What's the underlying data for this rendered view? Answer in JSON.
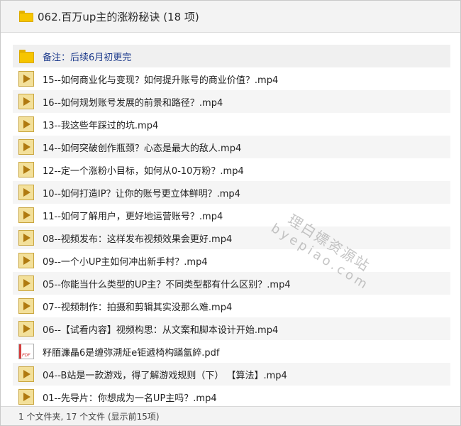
{
  "window": {
    "title": "062.百万up主的涨粉秘诀 (18 项)"
  },
  "items": [
    {
      "type": "folder",
      "name": "备注：后续6月初更完"
    },
    {
      "type": "video",
      "name": "15--如何商业化与变现？如何提升账号的商业价值？.mp4"
    },
    {
      "type": "video",
      "name": "16--如何规划账号发展的前景和路径？.mp4"
    },
    {
      "type": "video",
      "name": "13--我这些年踩过的坑.mp4"
    },
    {
      "type": "video",
      "name": "14--如何突破创作瓶颈？心态是最大的敌人.mp4"
    },
    {
      "type": "video",
      "name": "12--定一个涨粉小目标，如何从0-10万粉？.mp4"
    },
    {
      "type": "video",
      "name": "10--如何打造IP？让你的账号更立体鲜明？.mp4"
    },
    {
      "type": "video",
      "name": "11--如何了解用户，更好地运营账号？.mp4"
    },
    {
      "type": "video",
      "name": "08--视频发布：这样发布视频效果会更好.mp4"
    },
    {
      "type": "video",
      "name": "09--一个小UP主如何冲出新手村？.mp4"
    },
    {
      "type": "video",
      "name": "05--你能当什么类型的UP主？不同类型都有什么区别？.mp4"
    },
    {
      "type": "video",
      "name": "07--视频制作：拍摄和剪辑其实没那么难.mp4"
    },
    {
      "type": "video",
      "name": "06--【试看内容】视频构思：从文案和脚本设计开始.mp4"
    },
    {
      "type": "pdf",
      "name": "籽脜濂瞐6是缠弥溯炡e钜遞椅构蹣氳綷.pdf"
    },
    {
      "type": "video",
      "name": "04--B站是一款游戏，得了解游戏规则（下） 【算法】.mp4"
    },
    {
      "type": "video",
      "name": "01--先导片：你想成为一名UP主吗？.mp4"
    }
  ],
  "footer": {
    "status": "1 个文件夹, 17 个文件 (显示前15项)"
  },
  "watermark": {
    "line1": "理白嫖资源站",
    "line2": "byepiao.com"
  },
  "icons": {
    "folder": "folder-icon",
    "video": "video-file-icon",
    "pdf": "pdf-file-icon"
  },
  "colors": {
    "folder": "#f6c500",
    "video_bg": "#f3e09a",
    "play": "#b07a10",
    "note_text": "#1c3a8c",
    "pdf_accent": "#d43c3c"
  }
}
